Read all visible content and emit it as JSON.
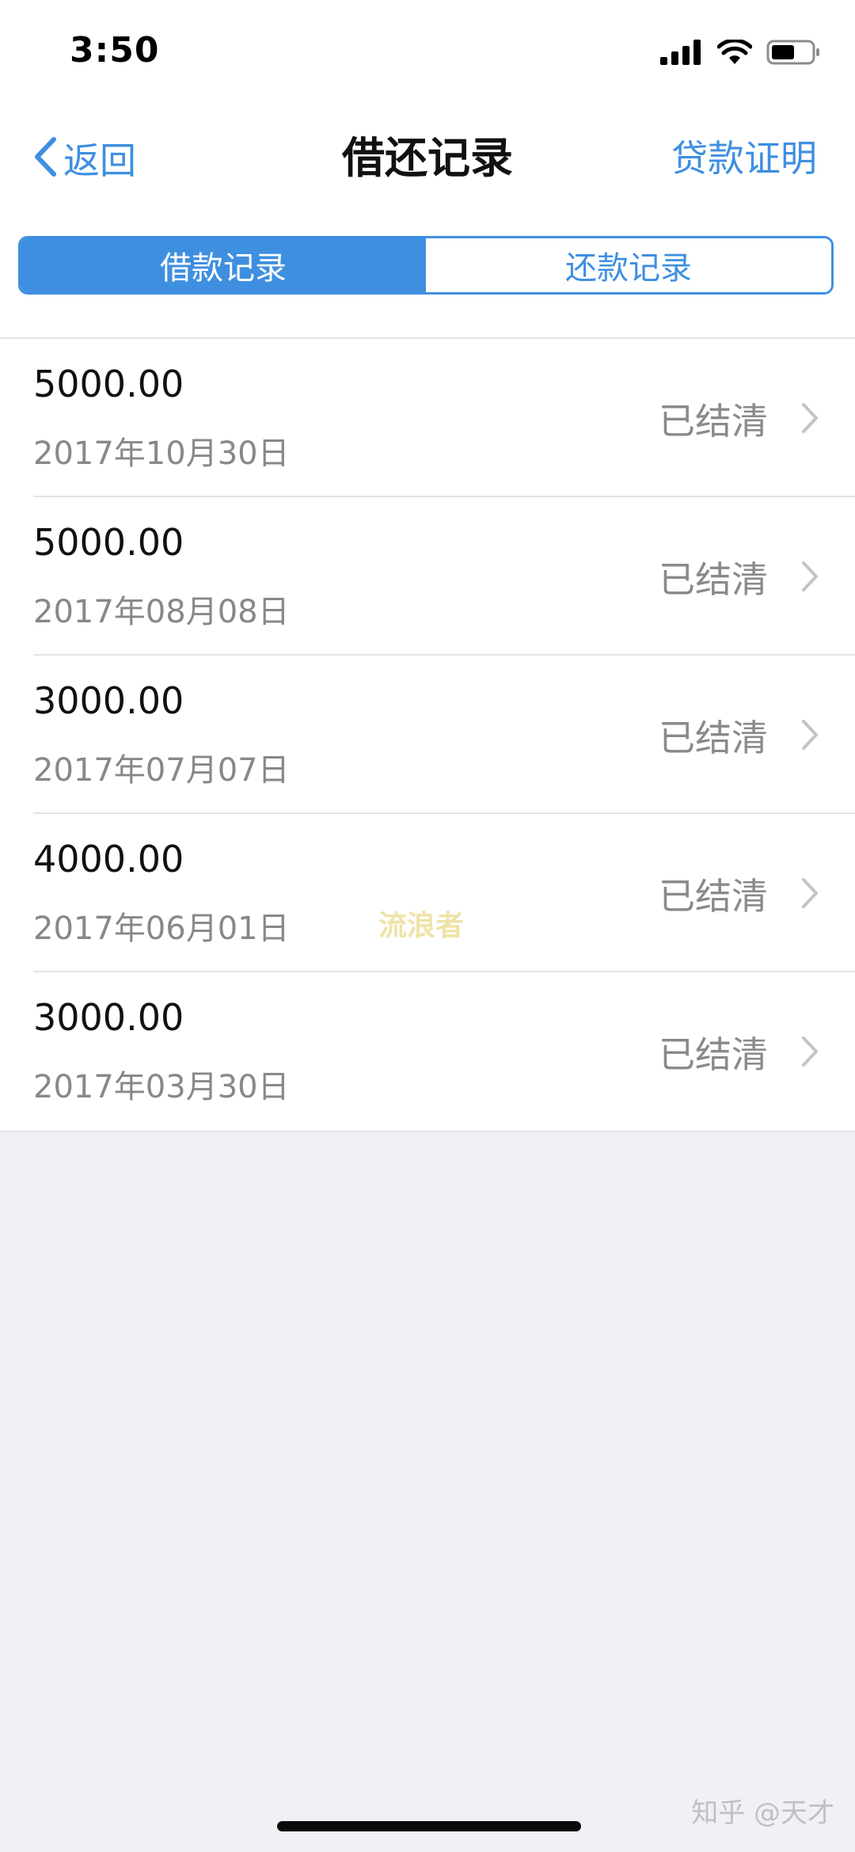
{
  "status_bar": {
    "time": "3:50"
  },
  "nav": {
    "back_label": "返回",
    "title": "借还记录",
    "action_label": "贷款证明"
  },
  "tabs": [
    {
      "label": "借款记录",
      "active": true
    },
    {
      "label": "还款记录",
      "active": false
    }
  ],
  "records": [
    {
      "amount": "5000.00",
      "date": "2017年10月30日",
      "status": "已结清"
    },
    {
      "amount": "5000.00",
      "date": "2017年08月08日",
      "status": "已结清"
    },
    {
      "amount": "3000.00",
      "date": "2017年07月07日",
      "status": "已结清"
    },
    {
      "amount": "4000.00",
      "date": "2017年06月01日",
      "status": "已结清"
    },
    {
      "amount": "3000.00",
      "date": "2017年03月30日",
      "status": "已结清"
    }
  ],
  "watermarks": {
    "center": "流浪者",
    "corner": "知乎 @天才"
  },
  "colors": {
    "accent": "#3f8fe0",
    "page_background": "#f0f0f5",
    "status_text": "#8a8a8a",
    "secondary_text": "#888888"
  },
  "icons": {
    "back": "chevron-left-icon",
    "row": "chevron-right-icon",
    "signal": "cellular-signal-icon",
    "wifi": "wifi-icon",
    "battery": "battery-icon"
  }
}
